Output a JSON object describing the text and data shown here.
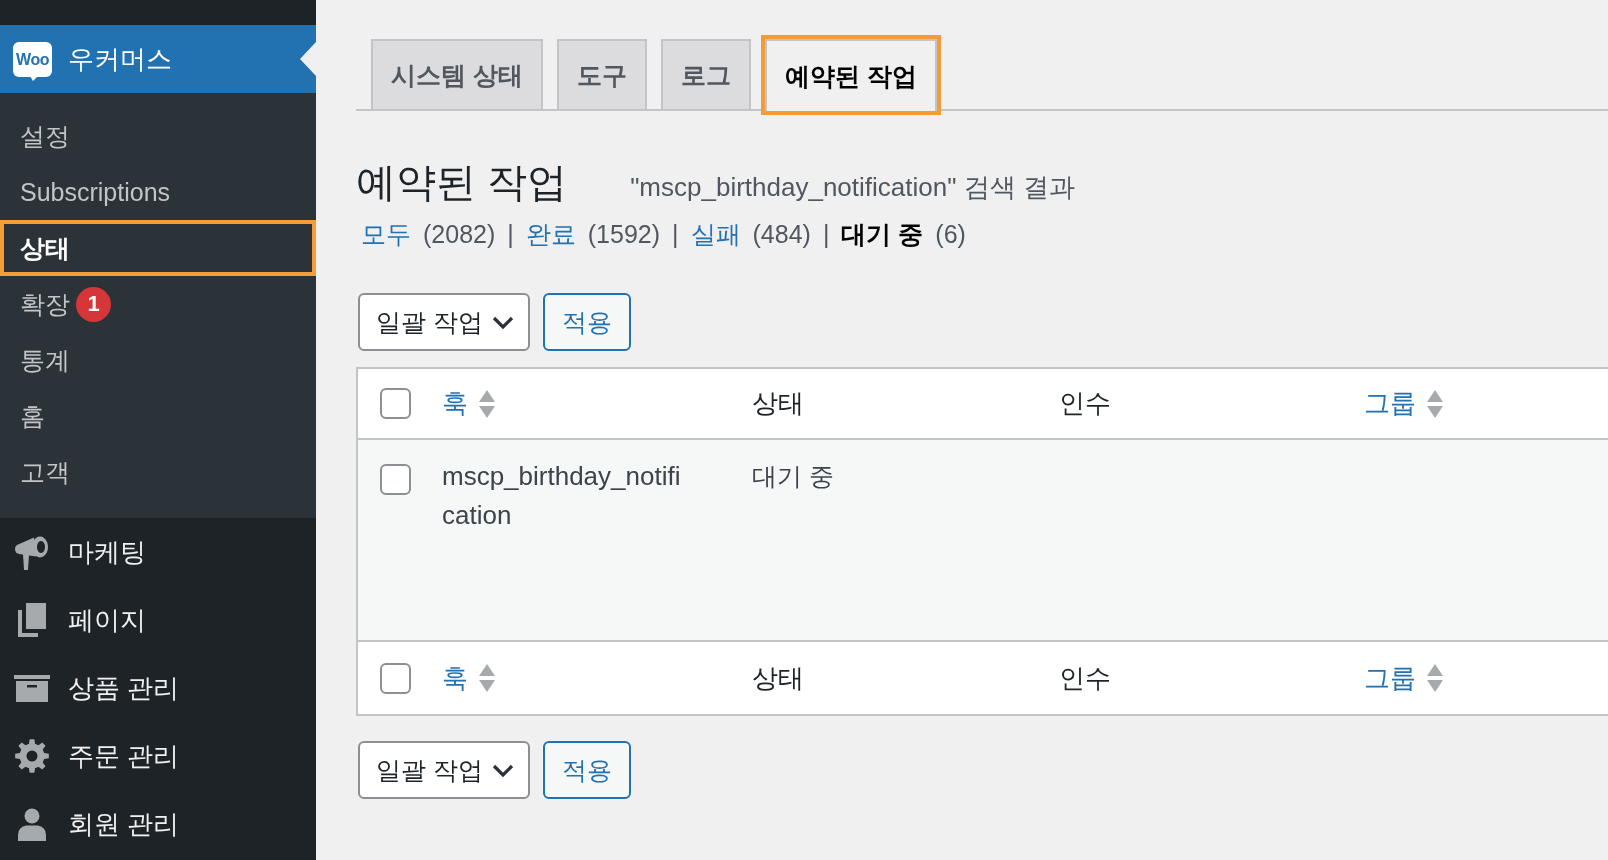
{
  "sidebar": {
    "current_menu": {
      "logo": "Woo",
      "label": "우커머스"
    },
    "submenu": [
      {
        "label": "설정",
        "selected": false,
        "highlighted": false
      },
      {
        "label": "Subscriptions",
        "selected": false,
        "highlighted": false
      },
      {
        "label": "상태",
        "selected": true,
        "highlighted": true
      },
      {
        "label": "확장",
        "selected": false,
        "highlighted": false,
        "badge": "1"
      },
      {
        "label": "통계",
        "selected": false,
        "highlighted": false
      },
      {
        "label": "홈",
        "selected": false,
        "highlighted": false
      },
      {
        "label": "고객",
        "selected": false,
        "highlighted": false
      }
    ],
    "menu": [
      {
        "label": "마케팅",
        "selected": false
      },
      {
        "label": "페이지",
        "selected": false
      },
      {
        "label": "상품 관리",
        "selected": false
      },
      {
        "label": "주문 관리",
        "selected": false
      },
      {
        "label": "회원 관리",
        "selected": false
      }
    ]
  },
  "tabs": [
    {
      "label": "시스템 상태",
      "selected": false,
      "highlighted": false
    },
    {
      "label": "도구",
      "selected": false,
      "highlighted": false
    },
    {
      "label": "로그",
      "selected": false,
      "highlighted": false
    },
    {
      "label": "예약된 작업",
      "selected": true,
      "highlighted": true
    }
  ],
  "page": {
    "title": "예약된 작업",
    "search_summary": "\"mscp_birthday_notification\" 검색 결과"
  },
  "filters": [
    {
      "label": "모두",
      "count": "(2082)",
      "separator": "|",
      "selected": false
    },
    {
      "label": "완료",
      "count": "(1592)",
      "separator": "|",
      "selected": false
    },
    {
      "label": "실패",
      "count": "(484)",
      "separator": "|",
      "selected": false
    },
    {
      "label": "대기 중",
      "count": "(6)",
      "selected": true
    }
  ],
  "bulk_actions_top": {
    "select": "일괄 작업",
    "apply": "적용"
  },
  "table": {
    "header": {
      "checked": false,
      "columns": [
        {
          "label": "훅",
          "sortable": true
        },
        {
          "label": "상태",
          "sortable": false
        },
        {
          "label": "인수",
          "sortable": false
        },
        {
          "label": "그룹",
          "sortable": true
        }
      ]
    },
    "rows": [
      {
        "checked": false,
        "hook": "mscp_birthday_notification",
        "status": "대기 중"
      }
    ],
    "footer": {
      "checked": false,
      "columns": [
        {
          "label": "훅",
          "sortable": true
        },
        {
          "label": "상태",
          "sortable": false
        },
        {
          "label": "인수",
          "sortable": false
        },
        {
          "label": "그룹",
          "sortable": true
        }
      ]
    }
  },
  "bulk_actions_bottom": {
    "select": "일괄 작업",
    "apply": "적용"
  }
}
